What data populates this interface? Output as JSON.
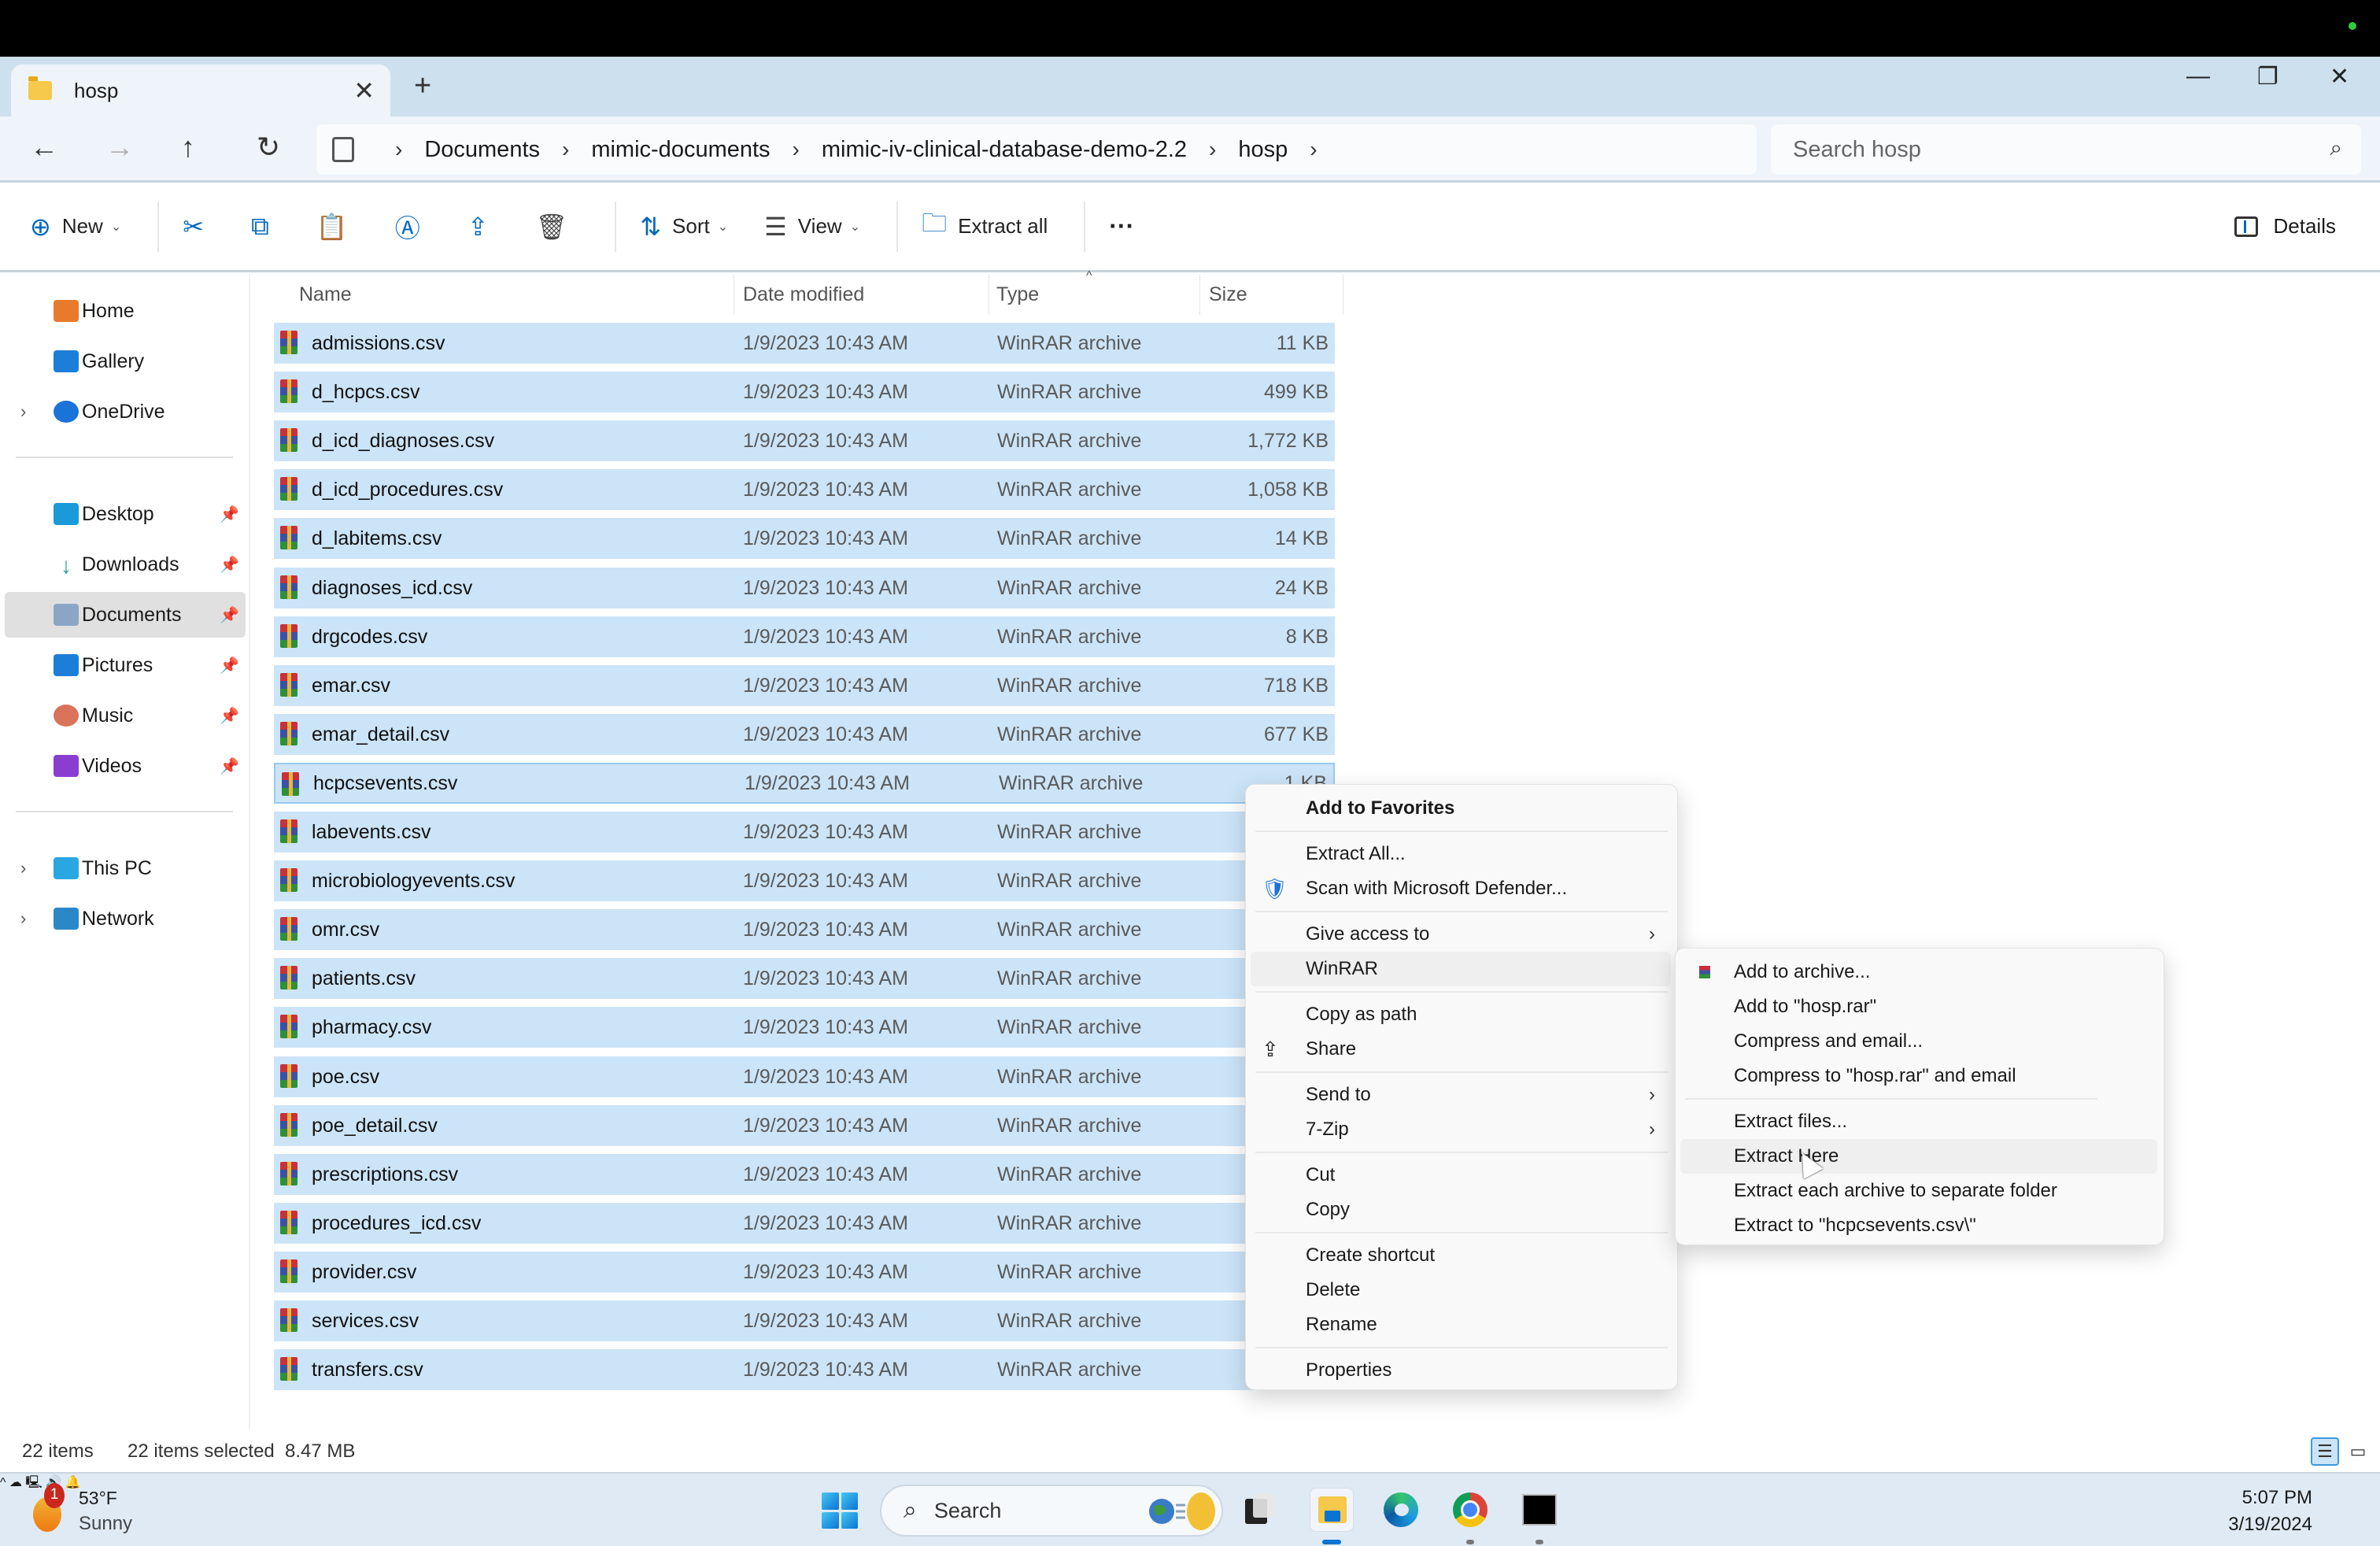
{
  "window": {
    "tab_title": "hosp",
    "new_tab_icon": "plus-icon",
    "controls": [
      "minimize-icon",
      "restore-icon",
      "close-icon"
    ]
  },
  "nav": {
    "back": "back-arrow-icon",
    "forward": "forward-arrow-icon",
    "up": "up-arrow-icon",
    "refresh": "refresh-icon"
  },
  "breadcrumb": [
    "Documents",
    "mimic-documents",
    "mimic-iv-clinical-database-demo-2.2",
    "hosp"
  ],
  "search": {
    "placeholder": "Search hosp"
  },
  "toolbar": {
    "new_label": "New",
    "sort_label": "Sort",
    "view_label": "View",
    "extract_all_label": "Extract all",
    "more_label": "...",
    "details_label": "Details",
    "icons": [
      "cut-icon",
      "copy-icon",
      "paste-icon",
      "rename-icon",
      "share-icon",
      "delete-icon"
    ]
  },
  "sidebar": {
    "items": [
      {
        "label": "Home",
        "icon": "home-icon"
      },
      {
        "label": "Gallery",
        "icon": "gallery-icon"
      },
      {
        "label": "OneDrive",
        "icon": "onedrive-icon",
        "expandable": true
      },
      {
        "label": "Desktop",
        "icon": "desktop-icon",
        "pinned": true
      },
      {
        "label": "Downloads",
        "icon": "downloads-icon",
        "pinned": true
      },
      {
        "label": "Documents",
        "icon": "documents-icon",
        "pinned": true,
        "selected": true
      },
      {
        "label": "Pictures",
        "icon": "pictures-icon",
        "pinned": true
      },
      {
        "label": "Music",
        "icon": "music-icon",
        "pinned": true
      },
      {
        "label": "Videos",
        "icon": "videos-icon",
        "pinned": true
      },
      {
        "label": "This PC",
        "icon": "this-pc-icon",
        "expandable": true
      },
      {
        "label": "Network",
        "icon": "network-icon",
        "expandable": true
      }
    ]
  },
  "columns": {
    "name": "Name",
    "date": "Date modified",
    "type": "Type",
    "size": "Size"
  },
  "files": [
    {
      "name": "admissions.csv",
      "date": "1/9/2023 10:43 AM",
      "type": "WinRAR archive",
      "size": "11 KB"
    },
    {
      "name": "d_hcpcs.csv",
      "date": "1/9/2023 10:43 AM",
      "type": "WinRAR archive",
      "size": "499 KB"
    },
    {
      "name": "d_icd_diagnoses.csv",
      "date": "1/9/2023 10:43 AM",
      "type": "WinRAR archive",
      "size": "1,772 KB"
    },
    {
      "name": "d_icd_procedures.csv",
      "date": "1/9/2023 10:43 AM",
      "type": "WinRAR archive",
      "size": "1,058 KB"
    },
    {
      "name": "d_labitems.csv",
      "date": "1/9/2023 10:43 AM",
      "type": "WinRAR archive",
      "size": "14 KB"
    },
    {
      "name": "diagnoses_icd.csv",
      "date": "1/9/2023 10:43 AM",
      "type": "WinRAR archive",
      "size": "24 KB"
    },
    {
      "name": "drgcodes.csv",
      "date": "1/9/2023 10:43 AM",
      "type": "WinRAR archive",
      "size": "8 KB"
    },
    {
      "name": "emar.csv",
      "date": "1/9/2023 10:43 AM",
      "type": "WinRAR archive",
      "size": "718 KB"
    },
    {
      "name": "emar_detail.csv",
      "date": "1/9/2023 10:43 AM",
      "type": "WinRAR archive",
      "size": "677 KB"
    },
    {
      "name": "hcpcsevents.csv",
      "date": "1/9/2023 10:43 AM",
      "type": "WinRAR archive",
      "size": "1 KB"
    },
    {
      "name": "labevents.csv",
      "date": "1/9/2023 10:43 AM",
      "type": "WinRAR archive",
      "size": ""
    },
    {
      "name": "microbiologyevents.csv",
      "date": "1/9/2023 10:43 AM",
      "type": "WinRAR archive",
      "size": ""
    },
    {
      "name": "omr.csv",
      "date": "1/9/2023 10:43 AM",
      "type": "WinRAR archive",
      "size": ""
    },
    {
      "name": "patients.csv",
      "date": "1/9/2023 10:43 AM",
      "type": "WinRAR archive",
      "size": ""
    },
    {
      "name": "pharmacy.csv",
      "date": "1/9/2023 10:43 AM",
      "type": "WinRAR archive",
      "size": ""
    },
    {
      "name": "poe.csv",
      "date": "1/9/2023 10:43 AM",
      "type": "WinRAR archive",
      "size": ""
    },
    {
      "name": "poe_detail.csv",
      "date": "1/9/2023 10:43 AM",
      "type": "WinRAR archive",
      "size": ""
    },
    {
      "name": "prescriptions.csv",
      "date": "1/9/2023 10:43 AM",
      "type": "WinRAR archive",
      "size": ""
    },
    {
      "name": "procedures_icd.csv",
      "date": "1/9/2023 10:43 AM",
      "type": "WinRAR archive",
      "size": ""
    },
    {
      "name": "provider.csv",
      "date": "1/9/2023 10:43 AM",
      "type": "WinRAR archive",
      "size": ""
    },
    {
      "name": "services.csv",
      "date": "1/9/2023 10:43 AM",
      "type": "WinRAR archive",
      "size": ""
    },
    {
      "name": "transfers.csv",
      "date": "1/9/2023 10:43 AM",
      "type": "WinRAR archive",
      "size": ""
    }
  ],
  "status": {
    "count": "22 items",
    "selected": "22 items selected",
    "size": "8.47 MB"
  },
  "context_menu": {
    "items": [
      {
        "label": "Add to Favorites",
        "bold": true
      },
      {
        "sep": true
      },
      {
        "label": "Extract All..."
      },
      {
        "label": "Scan with Microsoft Defender...",
        "icon": "defender-shield-icon"
      },
      {
        "sep": true
      },
      {
        "label": "Give access to",
        "submenu": true
      },
      {
        "label": "WinRAR",
        "highlighted": true
      },
      {
        "sep": true
      },
      {
        "label": "Copy as path"
      },
      {
        "label": "Share",
        "icon": "share-icon"
      },
      {
        "sep": true
      },
      {
        "label": "Send to",
        "submenu": true
      },
      {
        "label": "7-Zip",
        "submenu": true
      },
      {
        "sep": true
      },
      {
        "label": "Cut"
      },
      {
        "label": "Copy"
      },
      {
        "sep": true
      },
      {
        "label": "Create shortcut"
      },
      {
        "label": "Delete"
      },
      {
        "label": "Rename"
      },
      {
        "sep": true
      },
      {
        "label": "Properties"
      }
    ]
  },
  "winrar_submenu": {
    "items": [
      {
        "label": "Add to archive...",
        "icon": "winrar-icon"
      },
      {
        "label": "Add to \"hosp.rar\""
      },
      {
        "label": "Compress and email..."
      },
      {
        "label": "Compress to \"hosp.rar\" and email"
      },
      {
        "sep": true
      },
      {
        "label": "Extract files..."
      },
      {
        "label": "Extract Here",
        "highlighted": true
      },
      {
        "label": "Extract each archive to separate folder"
      },
      {
        "label": "Extract to \"hcpcsevents.csv\\\""
      }
    ]
  },
  "taskbar": {
    "weather_temp": "53°F",
    "weather_cond": "Sunny",
    "weather_badge": "1",
    "search_label": "Search",
    "apps": [
      "task-view-icon",
      "file-explorer-icon",
      "edge-icon",
      "chrome-icon",
      "terminal-icon"
    ],
    "time": "5:07 PM",
    "date": "3/19/2024"
  }
}
